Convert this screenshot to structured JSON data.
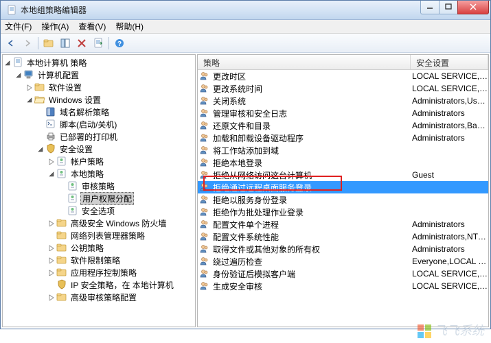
{
  "window": {
    "title": "本地组策略编辑器"
  },
  "menubar": {
    "file": "文件(F)",
    "action": "操作(A)",
    "view": "查看(V)",
    "help": "帮助(H)"
  },
  "tree": {
    "root": "本地计算机 策略",
    "computer_config": "计算机配置",
    "software_settings": "软件设置",
    "windows_settings": "Windows 设置",
    "name_res_policy": "域名解析策略",
    "scripts": "脚本(启动/关机)",
    "deployed_printers": "已部署的打印机",
    "security_settings": "安全设置",
    "account_policies": "帐户策略",
    "local_policies": "本地策略",
    "audit_policy": "审核策略",
    "user_rights": "用户权限分配",
    "security_options": "安全选项",
    "advanced_firewall": "高级安全 Windows 防火墙",
    "network_list": "网络列表管理器策略",
    "public_key": "公钥策略",
    "software_restrict": "软件限制策略",
    "app_control": "应用程序控制策略",
    "ip_security": "IP 安全策略，在 本地计算机",
    "advanced_audit": "高级审核策略配置"
  },
  "list": {
    "columns": {
      "policy": "策略",
      "security_setting": "安全设置"
    },
    "selected_index": 9,
    "rows": [
      {
        "name": "更改时区",
        "value": "LOCAL SERVICE,Administrators"
      },
      {
        "name": "更改系统时间",
        "value": "LOCAL SERVICE,Administrators"
      },
      {
        "name": "关闭系统",
        "value": "Administrators,Users"
      },
      {
        "name": "管理审核和安全日志",
        "value": "Administrators"
      },
      {
        "name": "还原文件和目录",
        "value": "Administrators,Backup Operators"
      },
      {
        "name": "加载和卸载设备驱动程序",
        "value": "Administrators"
      },
      {
        "name": "将工作站添加到域",
        "value": ""
      },
      {
        "name": "拒绝本地登录",
        "value": ""
      },
      {
        "name": "拒绝从网络访问这台计算机",
        "value": "Guest"
      },
      {
        "name": "拒绝通过远程桌面服务登录",
        "value": ""
      },
      {
        "name": "拒绝以服务身份登录",
        "value": ""
      },
      {
        "name": "拒绝作为批处理作业登录",
        "value": ""
      },
      {
        "name": "配置文件单个进程",
        "value": "Administrators"
      },
      {
        "name": "配置文件系统性能",
        "value": "Administrators,NT SERVICE"
      },
      {
        "name": "取得文件或其他对象的所有权",
        "value": "Administrators"
      },
      {
        "name": "绕过遍历检查",
        "value": "Everyone,LOCAL SERVICE"
      },
      {
        "name": "身份验证后模拟客户端",
        "value": "LOCAL SERVICE,NETWORK SERVICE"
      },
      {
        "name": "生成安全审核",
        "value": "LOCAL SERVICE,NETWORK SERVICE"
      }
    ]
  },
  "watermark": "飞飞系统"
}
